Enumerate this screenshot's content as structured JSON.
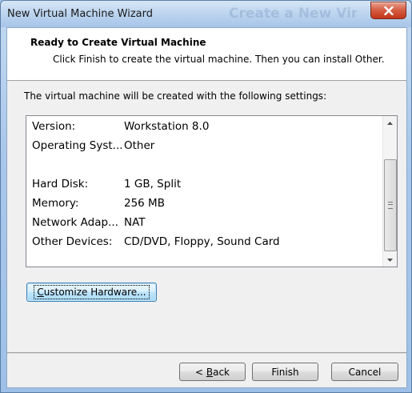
{
  "window": {
    "title": "New Virtual Machine Wizard",
    "background_title": "Create a New Virt"
  },
  "header": {
    "title": "Ready to Create Virtual Machine",
    "subtitle": "Click Finish to create the virtual machine. Then you can install Other."
  },
  "intro_text": "The virtual machine will be created with the following settings:",
  "settings": [
    {
      "label": "Version:",
      "value": "Workstation 8.0"
    },
    {
      "label": "Operating Syst...",
      "value": "Other"
    },
    {
      "label": "",
      "value": ""
    },
    {
      "label": "Hard Disk:",
      "value": "1 GB, Split"
    },
    {
      "label": "Memory:",
      "value": "256 MB"
    },
    {
      "label": "Network Adap...",
      "value": "NAT"
    },
    {
      "label": "Other Devices:",
      "value": "CD/DVD, Floppy, Sound Card"
    }
  ],
  "buttons": {
    "customize": {
      "prefix": "",
      "mnemonic": "C",
      "rest": "ustomize Hardware..."
    },
    "back": {
      "prefix": "< ",
      "mnemonic": "B",
      "rest": "ack"
    },
    "finish": "Finish",
    "cancel": "Cancel"
  },
  "colors": {
    "title_bar": "#b9d2ee",
    "close_button": "#c2361a",
    "dialog_bg": "#f0f0f0",
    "focus_blue": "#3c7fb1"
  }
}
